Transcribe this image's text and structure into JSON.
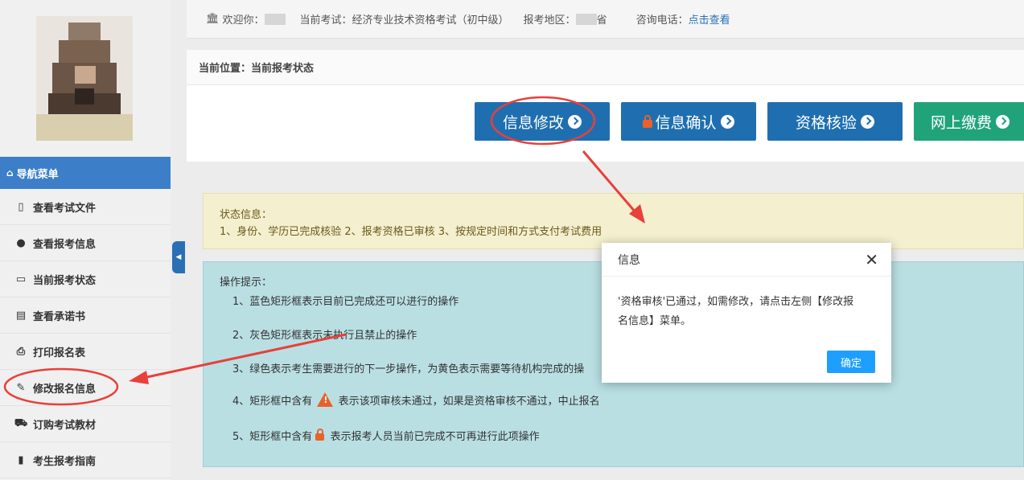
{
  "topbar": {
    "welcome_label": "欢迎你：",
    "exam_label": "当前考试：经济专业技术资格考试（初中级）",
    "region_label": "报考地区：",
    "region_suffix": "省",
    "phone_label": "咨询电话：",
    "phone_link": "点击查看"
  },
  "sidebar": {
    "nav_header": "导航菜单",
    "items": [
      {
        "label": "查看考试文件",
        "icon": "file-icon"
      },
      {
        "label": "查看报考信息",
        "icon": "info-icon"
      },
      {
        "label": "当前报考状态",
        "icon": "monitor-icon"
      },
      {
        "label": "查看承诺书",
        "icon": "card-icon"
      },
      {
        "label": "打印报名表",
        "icon": "print-icon"
      },
      {
        "label": "修改报名信息",
        "icon": "edit-icon"
      },
      {
        "label": "订购考试教材",
        "icon": "cart-icon"
      },
      {
        "label": "考生报考指南",
        "icon": "book-icon"
      }
    ]
  },
  "breadcrumb": "当前位置：当前报考状态",
  "steps": [
    {
      "label": "信息修改",
      "color": "#1f6fb0",
      "locked": false
    },
    {
      "label": "信息确认",
      "color": "#1f6fb0",
      "locked": true
    },
    {
      "label": "资格核验",
      "color": "#1f6fb0",
      "locked": false
    },
    {
      "label": "网上缴费",
      "color": "#21a37a",
      "locked": false
    }
  ],
  "status": {
    "title": "状态信息：",
    "text": "1、身份、学历已完成核验 2、报考资格已审核 3、按规定时间和方式支付考试费用"
  },
  "tips": {
    "title": "操作提示：",
    "tip1": "1、蓝色矩形框表示目前已完成还可以进行的操作",
    "tip2": "2、灰色矩形框表示未执行且禁止的操作",
    "tip3": "3、绿色表示考生需要进行的下一步操作，为黄色表示需要等待机构完成的操",
    "tip4_pre": "4、矩形框中含有",
    "tip4_post": "表示该项审核未通过，如果是资格审核不通过，中止报名",
    "tip5_pre": "5、矩形框中含有",
    "tip5_post": "表示报考人员当前已完成不可再进行此项操作"
  },
  "dialog": {
    "title": "信息",
    "close": "✕",
    "line1": "'资格审核'已通过，如需修改，请点击左侧【修改报",
    "line2": "名信息】菜单。",
    "ok": "确定"
  },
  "annotation_color": "#e8403a"
}
